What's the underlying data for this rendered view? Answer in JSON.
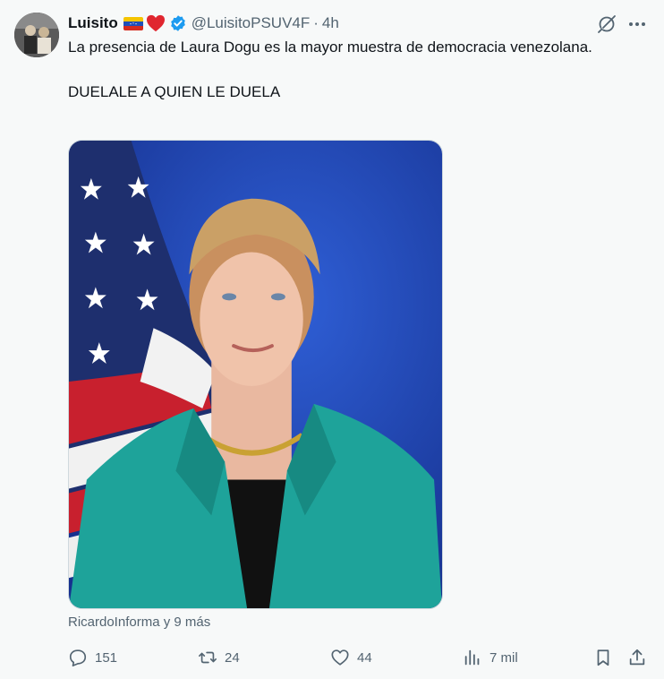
{
  "author": {
    "name": "Luisito",
    "handle": "@LuisitoPSUV4F",
    "separator": "·",
    "time": "4h"
  },
  "tweet": {
    "text_line1": "La presencia de Laura Dogu es la mayor muestra de democracia venezolana.",
    "text_line2": "DUELALE A QUIEN LE DUELA"
  },
  "media": {
    "tagged": "RicardoInforma y 9 más"
  },
  "actions": {
    "replies": "151",
    "reposts": "24",
    "likes": "44",
    "views": "7 mil"
  },
  "colors": {
    "background": "#f7f9f9",
    "text": "#0f1419",
    "secondary": "#536471",
    "verified": "#1d9bf0"
  },
  "icons": [
    "flag-venezuela-icon",
    "heart-icon",
    "verified-badge-icon",
    "grok-icon",
    "more-icon",
    "reply-icon",
    "repost-icon",
    "like-icon",
    "views-icon",
    "bookmark-icon",
    "share-icon"
  ]
}
